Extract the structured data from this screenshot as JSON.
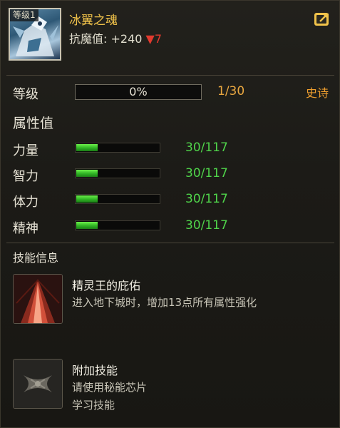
{
  "header": {
    "level_tag": "等级1",
    "item_name": "冰翼之魂",
    "resist_label": "抗魔值:",
    "resist_value": "+240",
    "resist_change": "▼7",
    "link_icon": "external-link-icon"
  },
  "level": {
    "label": "等级",
    "progress_text": "0%",
    "progress": 0,
    "count": "1/30",
    "grade": "史诗"
  },
  "attributes": {
    "title": "属性值",
    "items": [
      {
        "label": "力量",
        "value": "30/117",
        "fill": 0.256
      },
      {
        "label": "智力",
        "value": "30/117",
        "fill": 0.256
      },
      {
        "label": "体力",
        "value": "30/117",
        "fill": 0.256
      },
      {
        "label": "精神",
        "value": "30/117",
        "fill": 0.256
      }
    ]
  },
  "skills": {
    "title": "技能信息",
    "items": [
      {
        "name": "精灵王的庇佑",
        "desc1": "进入地下城时，增加13点所有属性强化",
        "desc2": "",
        "icon": "elf-king-blessing-icon"
      },
      {
        "name": "附加技能",
        "desc1": "请使用秘能芯片",
        "desc2": "学习技能",
        "icon": "empty-skill-slot-icon"
      }
    ]
  },
  "colors": {
    "name": "#f0c24a",
    "grade": "#ef9f2e",
    "stat_value": "#4fd34a",
    "down_arrow": "#e23a2e"
  }
}
